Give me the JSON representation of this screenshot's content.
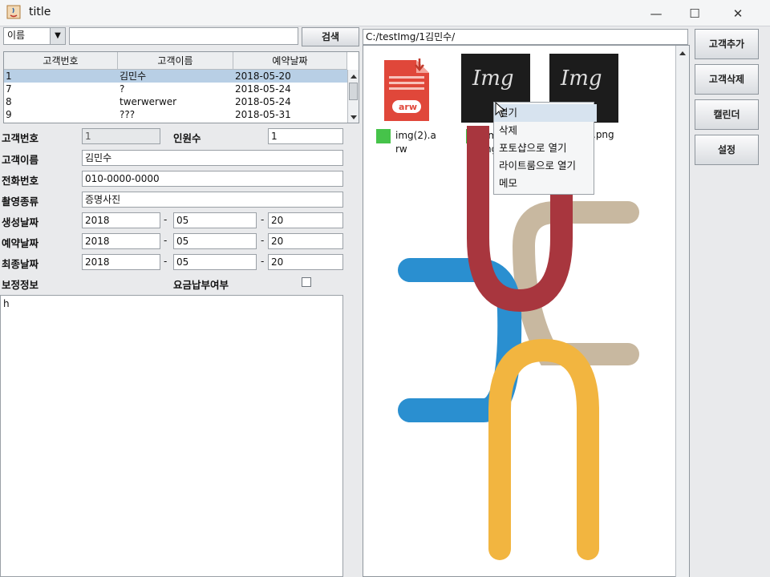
{
  "window": {
    "title": "title",
    "minimize": "—",
    "maximize": "☐",
    "close": "✕"
  },
  "search": {
    "combo_value": "이름",
    "combo_arrow": "▼",
    "input_value": "",
    "button": "검색"
  },
  "table": {
    "headers": [
      "고객번호",
      "고객이름",
      "예약날짜"
    ],
    "rows": [
      {
        "id": "1",
        "name": "김민수",
        "date": "2018-05-20"
      },
      {
        "id": "7",
        "name": "?",
        "date": "2018-05-24"
      },
      {
        "id": "8",
        "name": "twerwerwer",
        "date": "2018-05-24"
      },
      {
        "id": "9",
        "name": "???",
        "date": "2018-05-31"
      }
    ]
  },
  "form": {
    "customer_no_label": "고객번호",
    "customer_no": "1",
    "headcount_label": "인원수",
    "headcount": "1",
    "name_label": "고객이름",
    "name": "김민수",
    "phone_label": "전화번호",
    "phone": "010-0000-0000",
    "shoot_type_label": "촬영종류",
    "shoot_type": "증명사진",
    "created_label": "생성날짜",
    "created": {
      "year": "2018",
      "month": "05",
      "day": "20"
    },
    "reserved_label": "예약날짜",
    "reserved": {
      "year": "2018",
      "month": "05",
      "day": "20"
    },
    "final_label": "최종날짜",
    "final": {
      "year": "2018",
      "month": "05",
      "day": "20"
    },
    "dash": "-",
    "retouch_label": "보정정보",
    "retouch_text": "h",
    "paid_label": "요금납부여부"
  },
  "files": {
    "path": "C:/testImg/1김민수/",
    "items": [
      {
        "name": "img(2).arw",
        "icon_text": "arw"
      },
      {
        "name": "img(1).png",
        "thumb_text": "Img"
      },
      {
        "name": "img(3).png",
        "thumb_text": "Img"
      }
    ],
    "visible_labels": {
      "first_line1": "img(2).a",
      "first_line2": "rw",
      "second_partial": "im",
      "second_partial2": "ng",
      "third_partial": ".png"
    }
  },
  "context_menu": [
    "열기",
    "삭제",
    "포토샵으로 열기",
    "라이트룸으로 열기",
    "메모"
  ],
  "side_buttons": [
    "고객추가",
    "고객삭제",
    "캘린더",
    "설정"
  ],
  "colors": {
    "accent_selected": "#b8cfe5",
    "file_marker": "#46c34a",
    "pdf_red": "#e0473a"
  }
}
